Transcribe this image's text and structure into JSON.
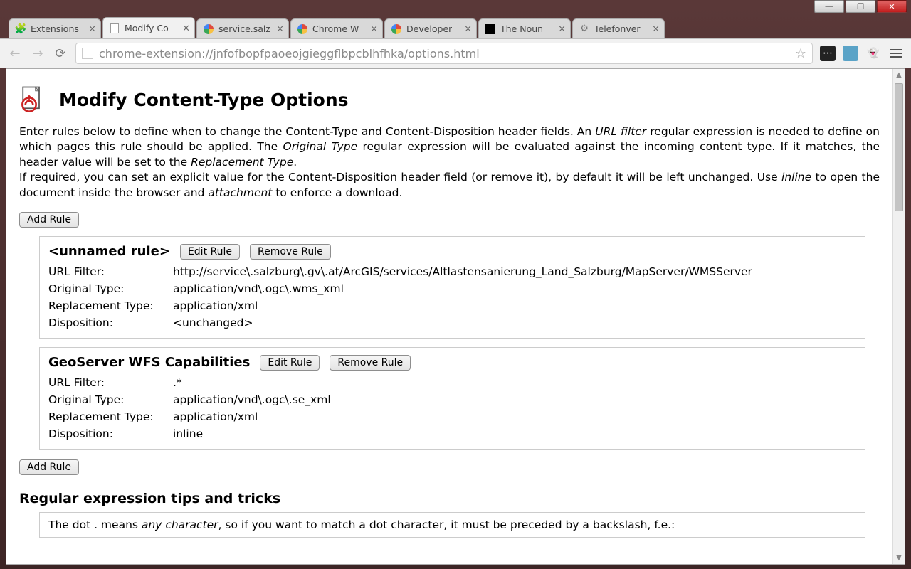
{
  "window": {
    "min_label": "—",
    "max_label": "❐",
    "close_label": "✕"
  },
  "tabs": [
    {
      "label": "Extensions",
      "icon": "puzzle"
    },
    {
      "label": "Modify Co",
      "icon": "doc",
      "active": true
    },
    {
      "label": "service.salz",
      "icon": "globe"
    },
    {
      "label": "Chrome W",
      "icon": "globe"
    },
    {
      "label": "Developer",
      "icon": "globe"
    },
    {
      "label": "The Noun",
      "icon": "square"
    },
    {
      "label": "Telefonver",
      "icon": "gear"
    }
  ],
  "omnibox": {
    "url": "chrome-extension://jnfofbopfpaoeojgieggflbpcblhfhka/options.html"
  },
  "page": {
    "title": "Modify Content-Type Options",
    "intro": {
      "p1a": "Enter rules below to define when to change the Content-Type and Content-Disposition header fields. An ",
      "p1em1": "URL filter",
      "p1b": " regular expression is needed to define on which pages this rule should be applied. The ",
      "p1em2": "Original Type",
      "p1c": " regular expression will be evaluated against the incoming content type. If it matches, the header value will be set to the ",
      "p1em3": "Replacement Type",
      "p1d": ".",
      "p2a": "If required, you can set an explicit value for the Content-Disposition header field (or remove it), by default it will be left unchanged. Use ",
      "p2em1": "inline",
      "p2b": " to open the document inside the browser and ",
      "p2em2": "attachment",
      "p2c": " to enforce a download."
    },
    "add_rule_label": "Add Rule",
    "edit_rule_label": "Edit Rule",
    "remove_rule_label": "Remove Rule",
    "labels": {
      "url_filter": "URL Filter:",
      "original_type": "Original Type:",
      "replacement_type": "Replacement Type:",
      "disposition": "Disposition:"
    },
    "rules": [
      {
        "name": "<unnamed rule>",
        "url_filter": "http://service\\.salzburg\\.gv\\.at/ArcGIS/services/Altlastensanierung_Land_Salzburg/MapServer/WMSServer",
        "original_type": "application/vnd\\.ogc\\.wms_xml",
        "replacement_type": "application/xml",
        "disposition": "<unchanged>"
      },
      {
        "name": "GeoServer WFS Capabilities",
        "url_filter": ".*",
        "original_type": "application/vnd\\.ogc\\.se_xml",
        "replacement_type": "application/xml",
        "disposition": "inline"
      }
    ],
    "tips_title": "Regular expression tips and tricks",
    "tips_line1a": "The dot . means ",
    "tips_line1em": "any character",
    "tips_line1b": ", so if you want to match a dot character, it must be preceded by a backslash, f.e.:"
  }
}
